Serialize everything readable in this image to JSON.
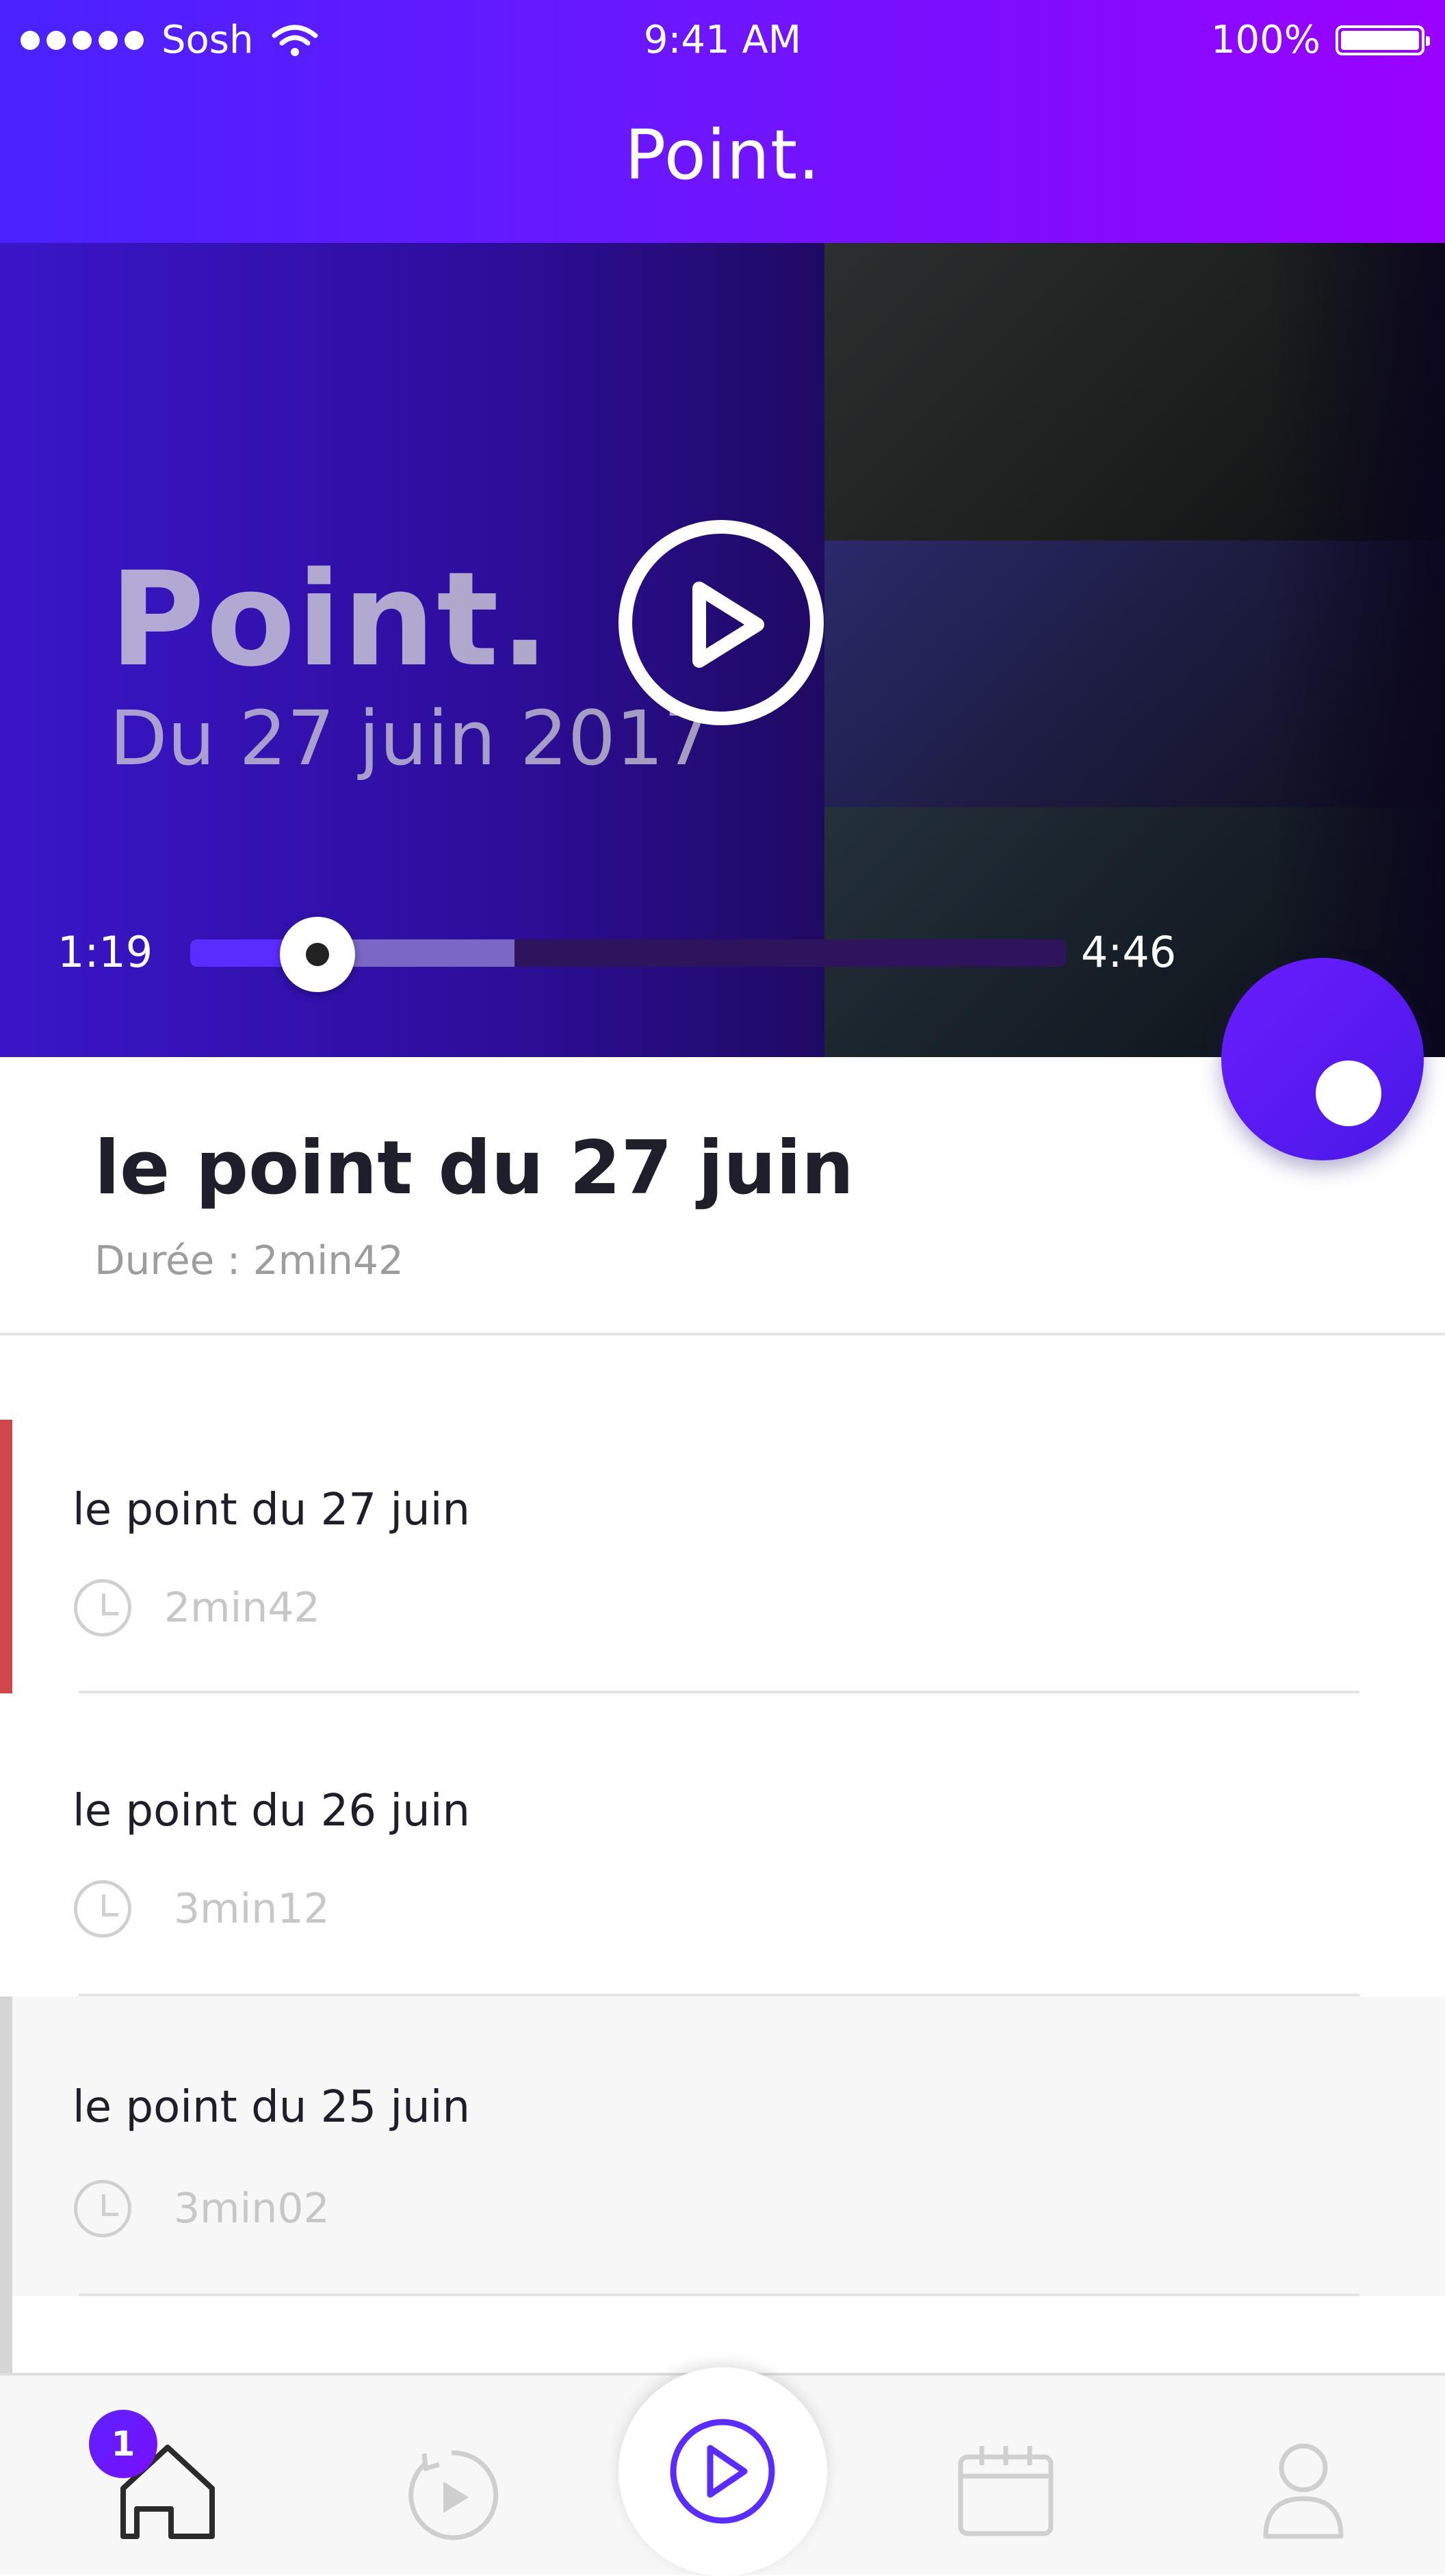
{
  "status_bar": {
    "carrier": "Sosh",
    "time": "9:41 AM",
    "battery": "100%"
  },
  "header": {
    "title": "Point."
  },
  "player": {
    "overlay_title": "Point.",
    "overlay_subtitle": "Du 27 juin 2017",
    "elapsed": "1:19",
    "total": "4:46",
    "progress": 0.145,
    "buffered": 0.37
  },
  "episode": {
    "title": "le point du 27 juin",
    "meta": "Durée : 2min42"
  },
  "list": [
    {
      "title": "le point du 27 juin",
      "duration": "2min42",
      "state": "playing"
    },
    {
      "title": "le point du 26 juin",
      "duration": "3min12",
      "state": "normal"
    },
    {
      "title": "le point du 25 juin",
      "duration": "3min02",
      "state": "pressed"
    }
  ],
  "tabbar": {
    "badge": "1",
    "tabs": [
      "home-icon",
      "replay-icon",
      "play-icon",
      "calendar-icon",
      "profile-icon"
    ]
  },
  "colors": {
    "accent": "#5a2cff",
    "playing_marker": "#d0474c",
    "pressed_marker": "#d6d6d6"
  }
}
